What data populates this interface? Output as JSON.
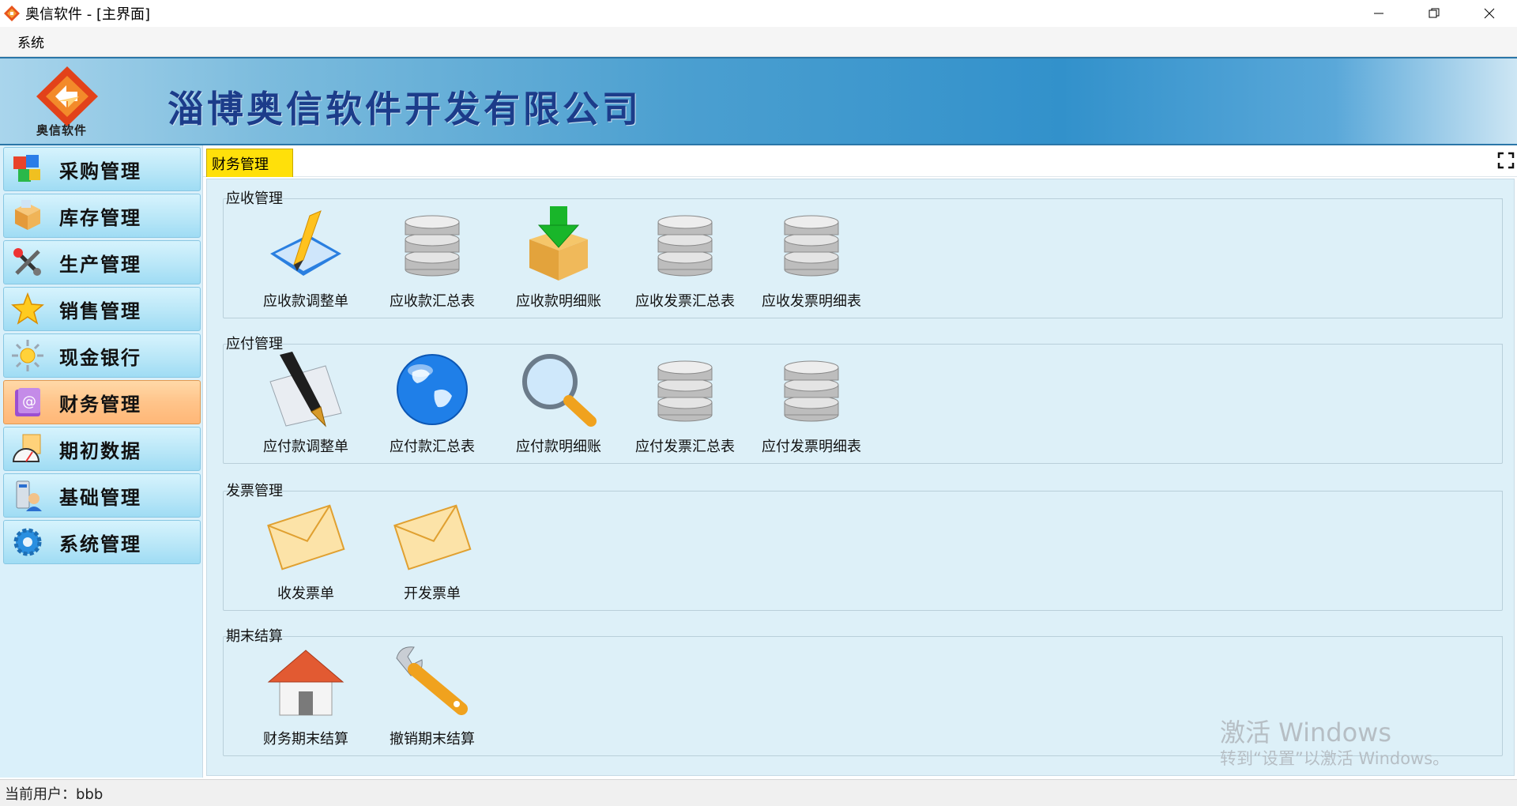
{
  "window": {
    "title": "奥信软件 - [主界面]",
    "controls": [
      "minimize-icon",
      "restore-icon",
      "close-icon"
    ]
  },
  "menu": {
    "items": [
      {
        "label": "系统"
      }
    ]
  },
  "banner": {
    "logo_text": "奥信软件",
    "company_name": "淄博奥信软件开发有限公司"
  },
  "sidebar": {
    "items": [
      {
        "label": "采购管理",
        "icon": "cubes-icon",
        "active": false
      },
      {
        "label": "库存管理",
        "icon": "boxes-icon",
        "active": false
      },
      {
        "label": "生产管理",
        "icon": "tools-icon",
        "active": false
      },
      {
        "label": "销售管理",
        "icon": "star-icon",
        "active": false
      },
      {
        "label": "现金银行",
        "icon": "sun-icon",
        "active": false
      },
      {
        "label": "财务管理",
        "icon": "at-book-icon",
        "active": true
      },
      {
        "label": "期初数据",
        "icon": "speedometer-icon",
        "active": false
      },
      {
        "label": "基础管理",
        "icon": "computer-user-icon",
        "active": false
      },
      {
        "label": "系统管理",
        "icon": "gear-icon",
        "active": false
      }
    ]
  },
  "tabs": [
    {
      "label": "财务管理"
    }
  ],
  "groups": [
    {
      "title": "应收管理",
      "items": [
        {
          "label": "应收款调整单",
          "icon": "pencil-document-icon"
        },
        {
          "label": "应收款汇总表",
          "icon": "database-icon"
        },
        {
          "label": "应收款明细账",
          "icon": "download-box-icon"
        },
        {
          "label": "应收发票汇总表",
          "icon": "database-icon"
        },
        {
          "label": "应收发票明细表",
          "icon": "database-icon"
        }
      ]
    },
    {
      "title": "应付管理",
      "items": [
        {
          "label": "应付款调整单",
          "icon": "fountain-pen-icon"
        },
        {
          "label": "应付款汇总表",
          "icon": "globe-icon"
        },
        {
          "label": "应付款明细账",
          "icon": "magnifier-icon"
        },
        {
          "label": "应付发票汇总表",
          "icon": "database-icon"
        },
        {
          "label": "应付发票明细表",
          "icon": "database-icon"
        }
      ]
    },
    {
      "title": "发票管理",
      "items": [
        {
          "label": "收发票单",
          "icon": "envelope-icon"
        },
        {
          "label": "开发票单",
          "icon": "envelope-icon"
        }
      ]
    },
    {
      "title": "期末结算",
      "items": [
        {
          "label": "财务期末结算",
          "icon": "house-icon"
        },
        {
          "label": "撤销期末结算",
          "icon": "wrench-icon"
        }
      ]
    }
  ],
  "watermark": {
    "line1": "激活 Windows",
    "line2": "转到“设置”以激活 Windows。"
  },
  "status": {
    "text": "当前用户：bbb"
  }
}
